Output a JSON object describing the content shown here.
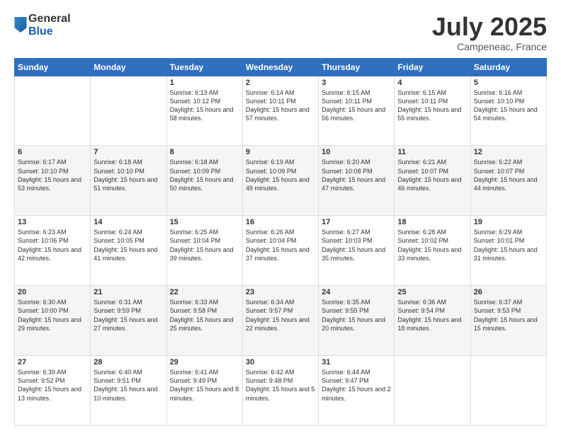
{
  "logo": {
    "general": "General",
    "blue": "Blue"
  },
  "header": {
    "month": "July 2025",
    "location": "Campeneac, France"
  },
  "weekdays": [
    "Sunday",
    "Monday",
    "Tuesday",
    "Wednesday",
    "Thursday",
    "Friday",
    "Saturday"
  ],
  "weeks": [
    [
      {
        "day": "",
        "sunrise": "",
        "sunset": "",
        "daylight": ""
      },
      {
        "day": "",
        "sunrise": "",
        "sunset": "",
        "daylight": ""
      },
      {
        "day": "1",
        "sunrise": "Sunrise: 6:13 AM",
        "sunset": "Sunset: 10:12 PM",
        "daylight": "Daylight: 15 hours and 58 minutes."
      },
      {
        "day": "2",
        "sunrise": "Sunrise: 6:14 AM",
        "sunset": "Sunset: 10:11 PM",
        "daylight": "Daylight: 15 hours and 57 minutes."
      },
      {
        "day": "3",
        "sunrise": "Sunrise: 6:15 AM",
        "sunset": "Sunset: 10:11 PM",
        "daylight": "Daylight: 15 hours and 56 minutes."
      },
      {
        "day": "4",
        "sunrise": "Sunrise: 6:15 AM",
        "sunset": "Sunset: 10:11 PM",
        "daylight": "Daylight: 15 hours and 55 minutes."
      },
      {
        "day": "5",
        "sunrise": "Sunrise: 6:16 AM",
        "sunset": "Sunset: 10:10 PM",
        "daylight": "Daylight: 15 hours and 54 minutes."
      }
    ],
    [
      {
        "day": "6",
        "sunrise": "Sunrise: 6:17 AM",
        "sunset": "Sunset: 10:10 PM",
        "daylight": "Daylight: 15 hours and 53 minutes."
      },
      {
        "day": "7",
        "sunrise": "Sunrise: 6:18 AM",
        "sunset": "Sunset: 10:10 PM",
        "daylight": "Daylight: 15 hours and 51 minutes."
      },
      {
        "day": "8",
        "sunrise": "Sunrise: 6:18 AM",
        "sunset": "Sunset: 10:09 PM",
        "daylight": "Daylight: 15 hours and 50 minutes."
      },
      {
        "day": "9",
        "sunrise": "Sunrise: 6:19 AM",
        "sunset": "Sunset: 10:09 PM",
        "daylight": "Daylight: 15 hours and 49 minutes."
      },
      {
        "day": "10",
        "sunrise": "Sunrise: 6:20 AM",
        "sunset": "Sunset: 10:08 PM",
        "daylight": "Daylight: 15 hours and 47 minutes."
      },
      {
        "day": "11",
        "sunrise": "Sunrise: 6:21 AM",
        "sunset": "Sunset: 10:07 PM",
        "daylight": "Daylight: 15 hours and 46 minutes."
      },
      {
        "day": "12",
        "sunrise": "Sunrise: 6:22 AM",
        "sunset": "Sunset: 10:07 PM",
        "daylight": "Daylight: 15 hours and 44 minutes."
      }
    ],
    [
      {
        "day": "13",
        "sunrise": "Sunrise: 6:23 AM",
        "sunset": "Sunset: 10:06 PM",
        "daylight": "Daylight: 15 hours and 42 minutes."
      },
      {
        "day": "14",
        "sunrise": "Sunrise: 6:24 AM",
        "sunset": "Sunset: 10:05 PM",
        "daylight": "Daylight: 15 hours and 41 minutes."
      },
      {
        "day": "15",
        "sunrise": "Sunrise: 6:25 AM",
        "sunset": "Sunset: 10:04 PM",
        "daylight": "Daylight: 15 hours and 39 minutes."
      },
      {
        "day": "16",
        "sunrise": "Sunrise: 6:26 AM",
        "sunset": "Sunset: 10:04 PM",
        "daylight": "Daylight: 15 hours and 37 minutes."
      },
      {
        "day": "17",
        "sunrise": "Sunrise: 6:27 AM",
        "sunset": "Sunset: 10:03 PM",
        "daylight": "Daylight: 15 hours and 35 minutes."
      },
      {
        "day": "18",
        "sunrise": "Sunrise: 6:28 AM",
        "sunset": "Sunset: 10:02 PM",
        "daylight": "Daylight: 15 hours and 33 minutes."
      },
      {
        "day": "19",
        "sunrise": "Sunrise: 6:29 AM",
        "sunset": "Sunset: 10:01 PM",
        "daylight": "Daylight: 15 hours and 31 minutes."
      }
    ],
    [
      {
        "day": "20",
        "sunrise": "Sunrise: 6:30 AM",
        "sunset": "Sunset: 10:00 PM",
        "daylight": "Daylight: 15 hours and 29 minutes."
      },
      {
        "day": "21",
        "sunrise": "Sunrise: 6:31 AM",
        "sunset": "Sunset: 9:59 PM",
        "daylight": "Daylight: 15 hours and 27 minutes."
      },
      {
        "day": "22",
        "sunrise": "Sunrise: 6:33 AM",
        "sunset": "Sunset: 9:58 PM",
        "daylight": "Daylight: 15 hours and 25 minutes."
      },
      {
        "day": "23",
        "sunrise": "Sunrise: 6:34 AM",
        "sunset": "Sunset: 9:57 PM",
        "daylight": "Daylight: 15 hours and 22 minutes."
      },
      {
        "day": "24",
        "sunrise": "Sunrise: 6:35 AM",
        "sunset": "Sunset: 9:55 PM",
        "daylight": "Daylight: 15 hours and 20 minutes."
      },
      {
        "day": "25",
        "sunrise": "Sunrise: 6:36 AM",
        "sunset": "Sunset: 9:54 PM",
        "daylight": "Daylight: 15 hours and 18 minutes."
      },
      {
        "day": "26",
        "sunrise": "Sunrise: 6:37 AM",
        "sunset": "Sunset: 9:53 PM",
        "daylight": "Daylight: 15 hours and 15 minutes."
      }
    ],
    [
      {
        "day": "27",
        "sunrise": "Sunrise: 6:39 AM",
        "sunset": "Sunset: 9:52 PM",
        "daylight": "Daylight: 15 hours and 13 minutes."
      },
      {
        "day": "28",
        "sunrise": "Sunrise: 6:40 AM",
        "sunset": "Sunset: 9:51 PM",
        "daylight": "Daylight: 15 hours and 10 minutes."
      },
      {
        "day": "29",
        "sunrise": "Sunrise: 6:41 AM",
        "sunset": "Sunset: 9:49 PM",
        "daylight": "Daylight: 15 hours and 8 minutes."
      },
      {
        "day": "30",
        "sunrise": "Sunrise: 6:42 AM",
        "sunset": "Sunset: 9:48 PM",
        "daylight": "Daylight: 15 hours and 5 minutes."
      },
      {
        "day": "31",
        "sunrise": "Sunrise: 6:44 AM",
        "sunset": "Sunset: 9:47 PM",
        "daylight": "Daylight: 15 hours and 2 minutes."
      },
      {
        "day": "",
        "sunrise": "",
        "sunset": "",
        "daylight": ""
      },
      {
        "day": "",
        "sunrise": "",
        "sunset": "",
        "daylight": ""
      }
    ]
  ]
}
